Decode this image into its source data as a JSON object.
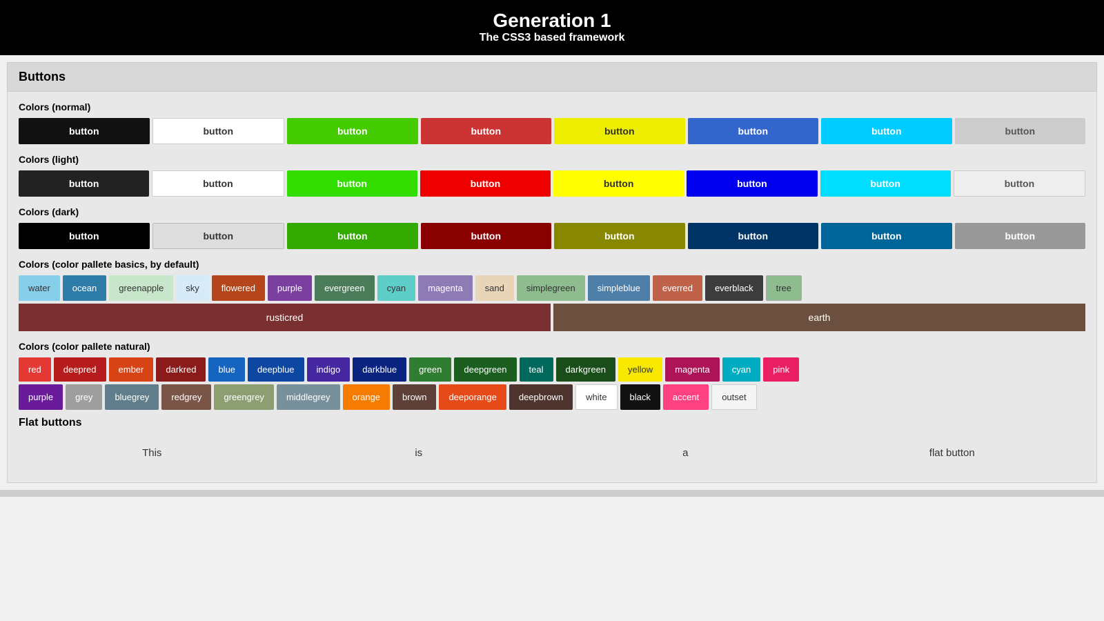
{
  "header": {
    "title": "Generation 1",
    "subtitle": "The CSS3 based framework"
  },
  "section": {
    "title": "Buttons"
  },
  "colors_normal": {
    "label": "Colors (normal)",
    "buttons": [
      "button",
      "button",
      "button",
      "button",
      "button",
      "button",
      "button",
      "button"
    ]
  },
  "colors_light": {
    "label": "Colors (light)",
    "buttons": [
      "button",
      "button",
      "button",
      "button",
      "button",
      "button",
      "button",
      "button"
    ]
  },
  "colors_dark": {
    "label": "Colors (dark)",
    "buttons": [
      "button",
      "button",
      "button",
      "button",
      "button",
      "button",
      "button",
      "button"
    ]
  },
  "colors_palette": {
    "label": "Colors (color pallete basics, by default)",
    "items": [
      "water",
      "ocean",
      "greenapple",
      "sky",
      "flowered",
      "purple",
      "evergreen",
      "cyan",
      "magenta",
      "sand",
      "simplegreen",
      "simpleblue",
      "everred",
      "everblack",
      "tree"
    ],
    "wide": [
      "rusticred",
      "earth"
    ]
  },
  "colors_natural": {
    "label": "Colors (color pallete natural)",
    "row1": [
      "red",
      "deepred",
      "ember",
      "darkred",
      "blue",
      "deepblue",
      "indigo",
      "darkblue",
      "green",
      "deepgreen",
      "teal",
      "darkgreen",
      "yellow",
      "magenta",
      "cyan",
      "pink"
    ],
    "row2": [
      "purple",
      "grey",
      "bluegrey",
      "redgrey",
      "greengrey",
      "middlegrey",
      "orange",
      "brown",
      "deeporange",
      "deepbrown",
      "white",
      "black",
      "accent",
      "outset"
    ]
  },
  "flat_buttons": {
    "label": "Flat buttons",
    "items": [
      "This",
      "is",
      "a",
      "flat button"
    ]
  }
}
